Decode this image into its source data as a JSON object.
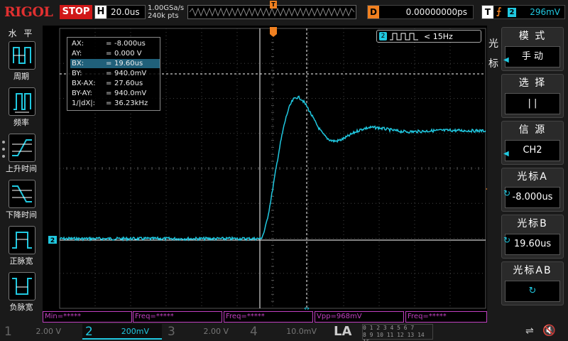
{
  "brand": "RIGOL",
  "run_state": "STOP",
  "horizontal": {
    "key": "H",
    "timebase": "20.0us",
    "sample_rate": "1.00GSa/s",
    "points": "240k pts"
  },
  "delay": {
    "key": "D",
    "value": "0.00000000ps"
  },
  "trigger": {
    "key": "T",
    "channel": "2",
    "level": "296mV"
  },
  "left_menu": {
    "title": "水 平",
    "items": [
      {
        "label": "周期",
        "icon": "period-icon"
      },
      {
        "label": "频率",
        "icon": "frequency-icon"
      },
      {
        "label": "上升时间",
        "icon": "rise-time-icon"
      },
      {
        "label": "下降时间",
        "icon": "fall-time-icon"
      },
      {
        "label": "正脉宽",
        "icon": "positive-width-icon"
      },
      {
        "label": "负脉宽",
        "icon": "negative-width-icon"
      }
    ]
  },
  "right_menu": {
    "title": "光标",
    "items": [
      {
        "header": "模 式",
        "value": "手 动"
      },
      {
        "header": "选 择",
        "value": "| |"
      },
      {
        "header": "信 源",
        "value": "CH2"
      },
      {
        "header": "光标A",
        "value": "-8.000us"
      },
      {
        "header": "光标B",
        "value": "19.60us"
      },
      {
        "header": "光标AB",
        "value": ""
      }
    ]
  },
  "cursor_readout": [
    {
      "key": "AX:",
      "value": "-8.000us"
    },
    {
      "key": "AY:",
      "value": "0.000 V"
    },
    {
      "key": "BX:",
      "value": "19.60us"
    },
    {
      "key": "BY:",
      "value": "940.0mV"
    },
    {
      "key": "BX-AX:",
      "value": "27.60us"
    },
    {
      "key": "BY-AY:",
      "value": "940.0mV"
    },
    {
      "key": "1/|dX|:",
      "value": "36.23kHz"
    }
  ],
  "freq_counter": {
    "channel": "2",
    "value": "< 15Hz"
  },
  "measurements": [
    "Min=*****",
    "Freq=*****",
    "Freq=*****",
    "Vpp=968mV",
    "Freq=*****"
  ],
  "channels": [
    {
      "num": "1",
      "scale": "2.00 V",
      "color": "#666666",
      "active": false
    },
    {
      "num": "2",
      "scale": "200mV",
      "color": "#20c8e0",
      "active": true
    },
    {
      "num": "3",
      "scale": "2.00 V",
      "color": "#666666",
      "active": false
    },
    {
      "num": "4",
      "scale": "10.0mV",
      "color": "#666666",
      "active": false
    }
  ],
  "la_label": "LA",
  "digital_channels": [
    "0 1 2 3  4 5 6 7",
    "8 9 10 11  12 13 14 15"
  ],
  "ch2_marker": "2",
  "trigger_marker": "T",
  "colors": {
    "trace": "#20c8e0",
    "trigger": "#f08020",
    "stop": "#d01818",
    "measure": "#c040c0"
  }
}
